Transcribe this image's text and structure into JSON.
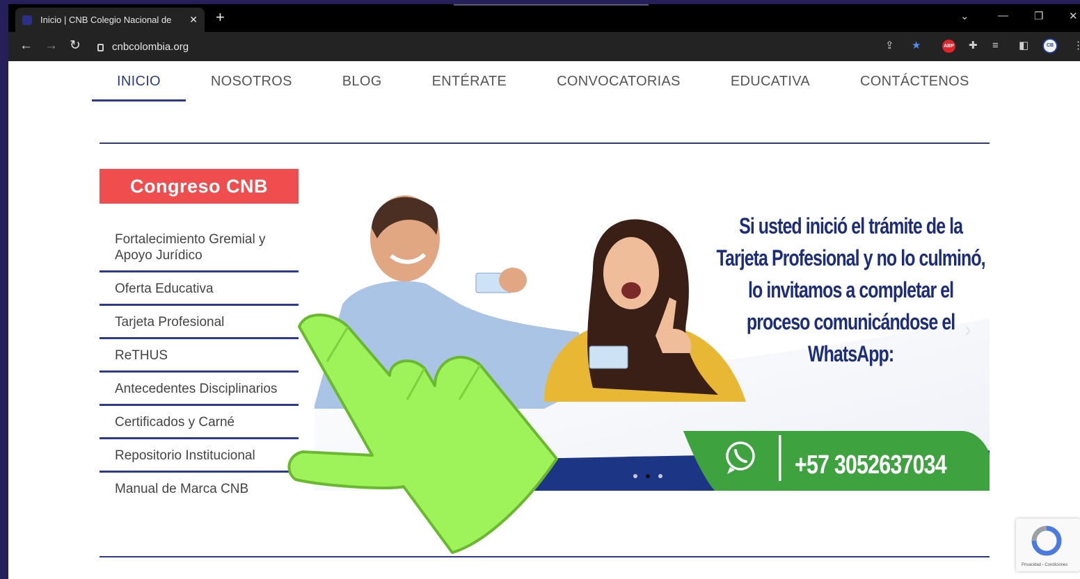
{
  "browser": {
    "tab_title": "Inicio | CNB Colegio Nacional de",
    "tab_close": "✕",
    "new_tab": "+",
    "url": "cnbcolombia.org",
    "abp_label": "ABP",
    "avatar_initials": "CB"
  },
  "nav": {
    "items": [
      "INICIO",
      "NOSOTROS",
      "BLOG",
      "ENTÉRATE",
      "CONVOCATORIAS",
      "EDUCATIVA",
      "CONTÁCTENOS"
    ],
    "active": "INICIO"
  },
  "sidebar": {
    "heading": "Congreso CNB",
    "items": [
      "Fortalecimiento Gremial y Apoyo Jurídico",
      "Oferta Educativa",
      "Tarjeta Profesional",
      "ReTHUS",
      "Antecedentes Disciplinarios",
      "Certificados y Carné",
      "Repositorio Institucional",
      "Manual de Marca CNB"
    ]
  },
  "banner": {
    "line1": "Si usted inició el trámite de la",
    "line2": "Tarjeta Profesional y no lo culminó,",
    "line3": "lo invitamos a completar el",
    "line4": "proceso comunicándose el",
    "line5": "WhatsApp:",
    "phone": "+57 3052637034",
    "slide_count": 3,
    "active_slide": 2
  },
  "recaptcha": {
    "label": "Privacidad - Condiciones"
  },
  "colors": {
    "brand_blue": "#2b3a8f",
    "congreso_red": "#f04e4e",
    "whatsapp_green": "#3ea33e",
    "hand_green": "#9ef25a"
  }
}
